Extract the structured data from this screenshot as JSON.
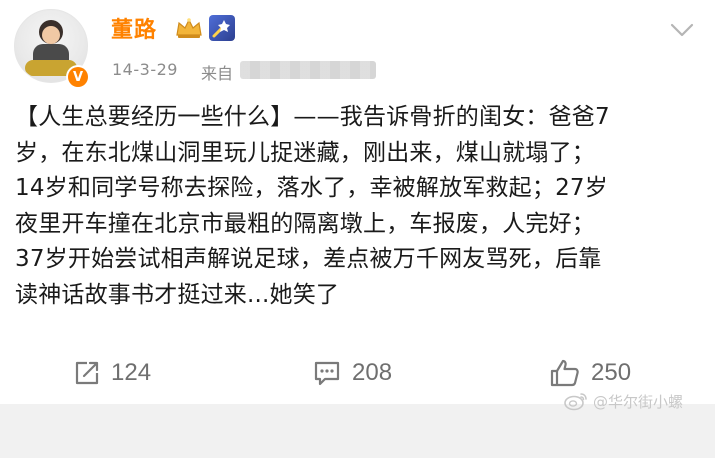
{
  "user": {
    "name": "董路",
    "avatar_icon": "avatar-photo",
    "verified_icon": "verified-v-badge",
    "verified_glyph": "V"
  },
  "post": {
    "timestamp": "14-3-29",
    "source_label": "来自",
    "lines": [
      "【人生总要经历一些什么】——我告诉骨折的闺女：爸爸7",
      "岁，在东北煤山洞里玩儿捉迷藏，刚出来，煤山就塌了；",
      "14岁和同学号称去探险，落水了，幸被解放军救起；27岁",
      "夜里开车撞在北京市最粗的隔离墩上，车报废，人完好；",
      "37岁开始尝试相声解说足球，差点被万千网友骂死，后靠",
      "读神话故事书才挺过来...她笑了"
    ]
  },
  "actions": {
    "repost_count": "124",
    "comment_count": "208",
    "like_count": "250"
  },
  "watermark": {
    "text": "@华尔街小螺"
  },
  "colors": {
    "name": "#ff8200",
    "meta": "#8c8c8c",
    "action": "#6f6f6f",
    "band": "#f1f1f1"
  }
}
